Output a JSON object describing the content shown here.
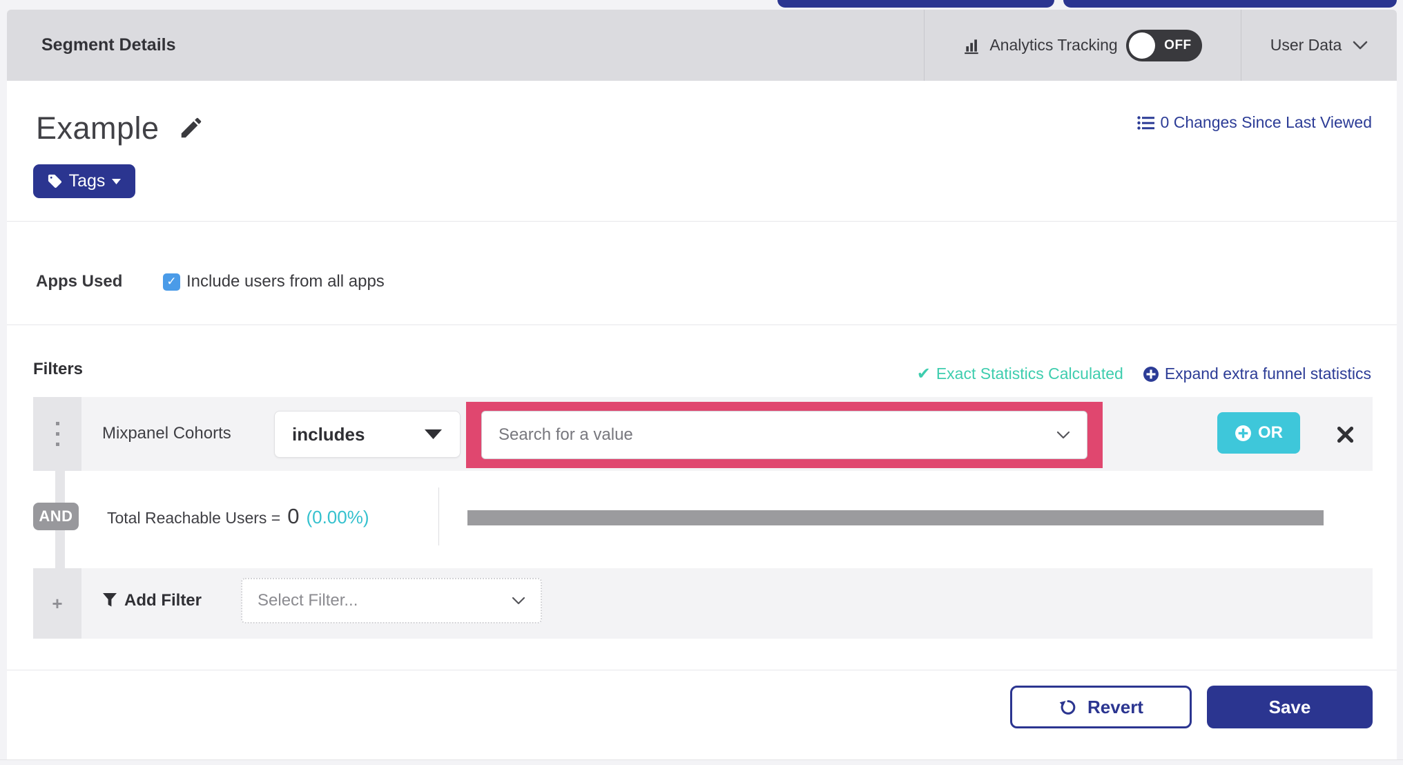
{
  "header": {
    "title": "Segment Details",
    "analytics_tracking_label": "Analytics Tracking",
    "analytics_toggle_state": "OFF",
    "user_data_label": "User Data"
  },
  "segment": {
    "name": "Example",
    "tags_button_label": "Tags",
    "changes_link_label": "0 Changes Since Last Viewed"
  },
  "apps_used": {
    "label": "Apps Used",
    "checkbox_label": "Include users from all apps",
    "checkbox_checked": true,
    "checkbox_glyph": "✓"
  },
  "filters": {
    "heading": "Filters",
    "exact_stats_label": "Exact Statistics Calculated",
    "exact_stats_check_glyph": "✔",
    "expand_link_label": "Expand extra funnel statistics",
    "filter_row": {
      "name": "Mixpanel Cohorts",
      "operator_value": "includes",
      "value_placeholder": "Search for a value",
      "or_button_label": "OR"
    },
    "and_label": "AND",
    "reachable": {
      "label": "Total Reachable Users =",
      "value": "0",
      "percent": "(0.00%)"
    },
    "add_filter": {
      "label": "Add Filter",
      "plus_glyph": "+",
      "select_placeholder": "Select Filter..."
    }
  },
  "footer": {
    "revert_label": "Revert",
    "save_label": "Save"
  },
  "colors": {
    "navy": "#2b3590",
    "link": "#2c3c96",
    "teal": "#3ec7da",
    "green": "#3ecdae",
    "cyan": "#35c1ce",
    "highlight-pink": "#e0476f",
    "checkbox-blue": "#4a9be8"
  }
}
